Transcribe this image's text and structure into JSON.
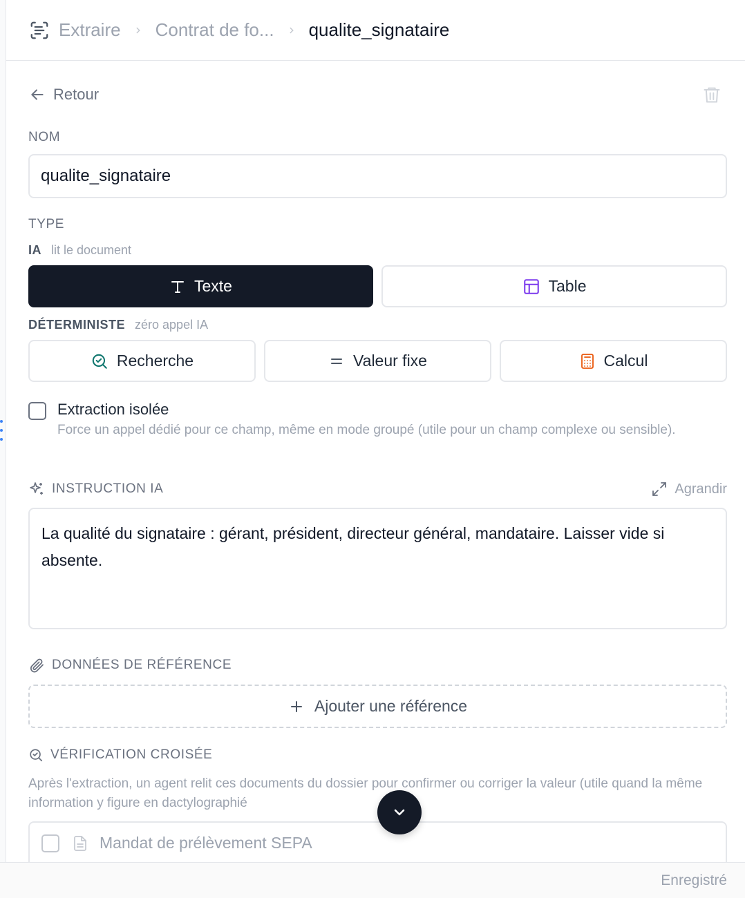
{
  "breadcrumb": {
    "app": "Extraire",
    "parent": "Contrat de fo...",
    "current": "qualite_signataire"
  },
  "back_label": "Retour",
  "name_section": {
    "label": "NOM",
    "value": "qualite_signataire"
  },
  "type_section": {
    "label": "TYPE",
    "ai_group": {
      "title": "IA",
      "subtitle": "lit le document"
    },
    "ai_options": [
      {
        "label": "Texte",
        "icon": "text-type-icon",
        "selected": true
      },
      {
        "label": "Table",
        "icon": "table-icon",
        "selected": false
      }
    ],
    "det_group": {
      "title": "DÉTERMINISTE",
      "subtitle": "zéro appel IA"
    },
    "det_options": [
      {
        "label": "Recherche",
        "icon": "search-check-icon"
      },
      {
        "label": "Valeur fixe",
        "icon": "equals-icon"
      },
      {
        "label": "Calcul",
        "icon": "calculator-icon"
      }
    ]
  },
  "isolated_extraction": {
    "label": "Extraction isolée",
    "checked": false,
    "help": "Force un appel dédié pour ce champ, même en mode groupé (utile pour un champ complexe ou sensible)."
  },
  "instruction": {
    "label": "INSTRUCTION IA",
    "expand_label": "Agrandir",
    "text": "La qualité du signataire : gérant, président, directeur général, mandataire. Laisser vide si absente."
  },
  "reference_data": {
    "label": "DONNÉES DE RÉFÉRENCE",
    "add_label": "Ajouter une référence"
  },
  "cross_check": {
    "label": "VÉRIFICATION CROISÉE",
    "help": "Après l'extraction, un agent relit ces documents du dossier pour confirmer ou corriger la valeur (utile quand la même information y figure en dactylographié",
    "documents": [
      {
        "label": "Mandat de prélèvement SEPA",
        "checked": false
      }
    ]
  },
  "footer": {
    "status": "Enregistré"
  },
  "colors": {
    "primary_dark": "#141a27",
    "table_icon": "#7c3aed",
    "search_icon": "#0f766e",
    "calc_icon": "#ea580c",
    "rail_handle": "#3b82f6"
  }
}
